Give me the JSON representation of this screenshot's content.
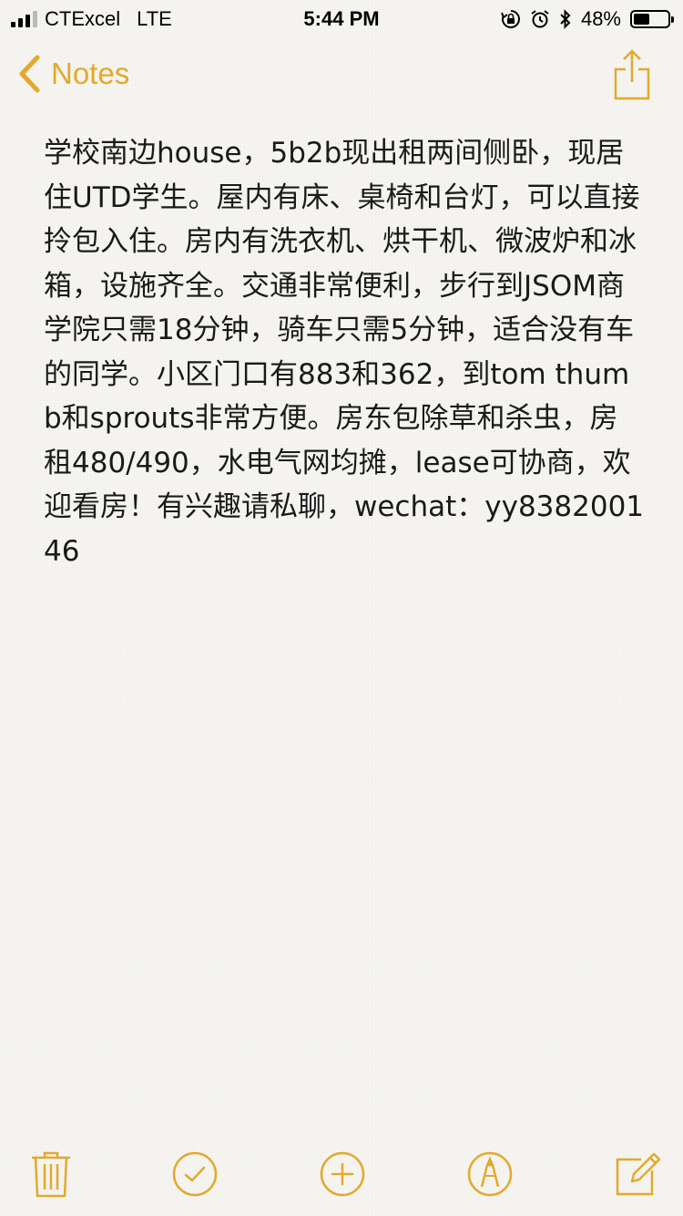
{
  "status_bar": {
    "carrier": "CTExcel",
    "network": "LTE",
    "time": "5:44 PM",
    "battery_percent": "48%",
    "battery_level": 0.48,
    "signal_bars_active": 3
  },
  "nav": {
    "back_label": "Notes"
  },
  "note": {
    "text": "学校南边house，5b2b现出租两间侧卧，现居住UTD学生。屋内有床、桌椅和台灯，可以直接拎包入住。房内有洗衣机、烘干机、微波炉和冰箱，设施齐全。交通非常便利，步行到JSOM商学院只需18分钟，骑车只需5分钟，适合没有车的同学。小区门口有883和362，到tom thumb和sprouts非常方便。房东包除草和杀虫，房租480/490，水电气网均摊，lease可协商，欢迎看房！有兴趣请私聊，wechat：yy838200146"
  },
  "toolbar": {
    "items": [
      {
        "icon": "trash-icon"
      },
      {
        "icon": "checklist-icon"
      },
      {
        "icon": "add-icon"
      },
      {
        "icon": "markup-icon"
      },
      {
        "icon": "compose-icon"
      }
    ]
  },
  "colors": {
    "accent": "#e3a92d",
    "background": "#f6f5f1",
    "text": "#1a1a1a"
  }
}
